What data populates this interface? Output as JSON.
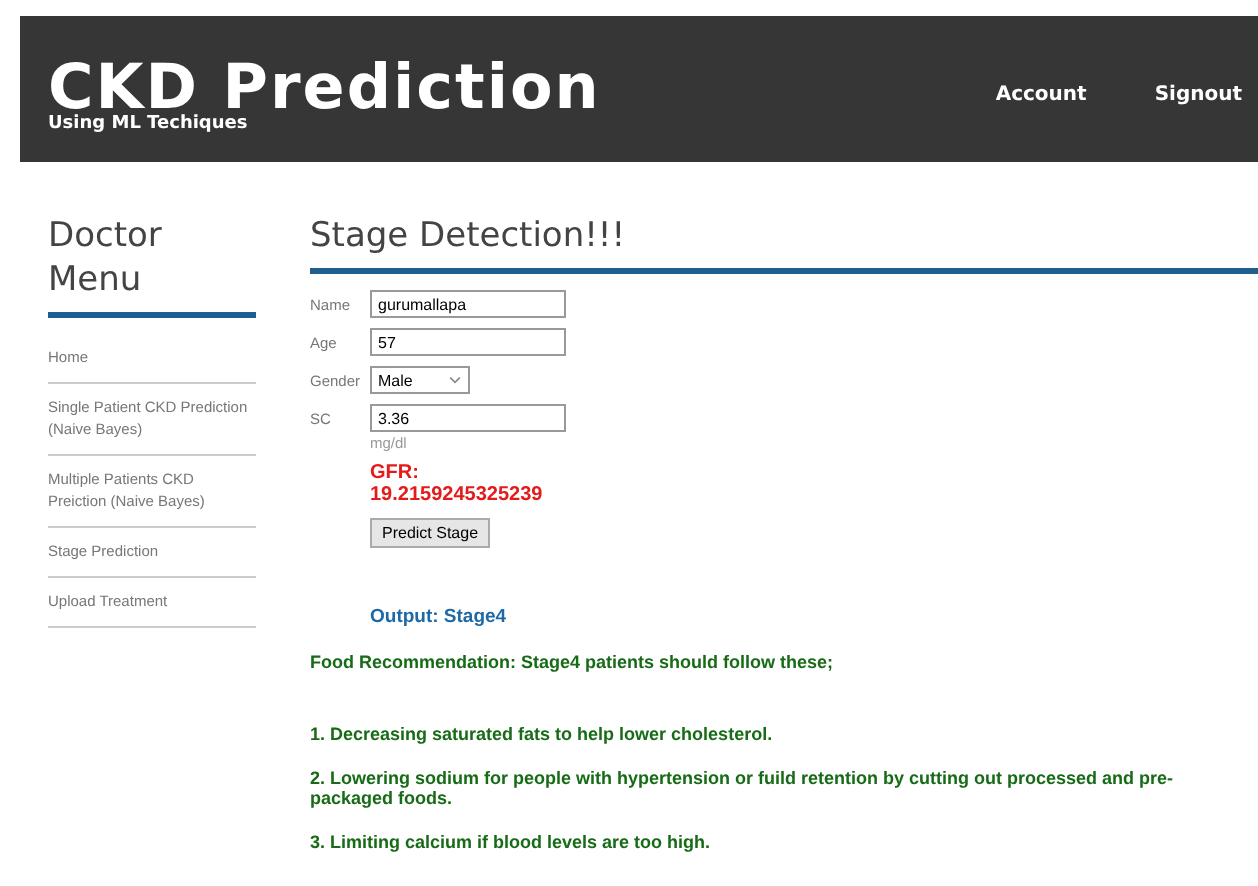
{
  "header": {
    "title": "CKD Prediction",
    "subtitle": "Using ML Techiques",
    "nav": [
      "Account",
      "Signout"
    ]
  },
  "sidebar": {
    "title": "Doctor Menu",
    "items": [
      "Home",
      "Single Patient CKD Prediction (Naive Bayes)",
      "Multiple Patients CKD Preiction (Naive Bayes)",
      "Stage Prediction",
      "Upload Treatment"
    ]
  },
  "main": {
    "title": "Stage Detection!!!",
    "fields": [
      {
        "kind": "text",
        "label": "Name",
        "value": "gurumallapa"
      },
      {
        "kind": "text",
        "label": "Age",
        "value": "57"
      },
      {
        "kind": "select",
        "label": "Gender",
        "value": "Male"
      },
      {
        "kind": "text",
        "label": "SC",
        "value": "3.36",
        "unit": "mg/dl"
      }
    ],
    "gfr": "GFR: 19.2159245325239",
    "button": "Predict Stage",
    "output": "Output: Stage4",
    "recommendation": "Food Recommendation: Stage4 patients should follow these;",
    "tips": [
      "1. Decreasing saturated fats to help lower cholesterol.",
      "2. Lowering sodium for people with hypertension or fuild retention by cutting out processed and pre-packaged foods.",
      "3. Limiting calcium if blood levels are too high."
    ]
  }
}
